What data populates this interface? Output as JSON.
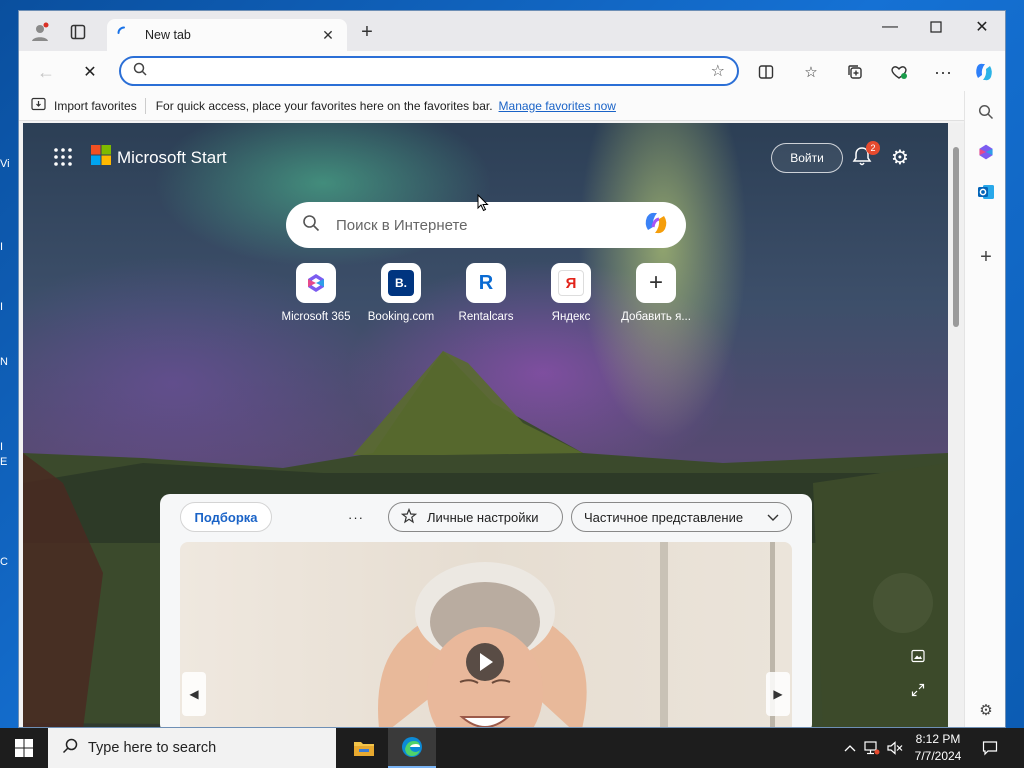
{
  "browser": {
    "tab_title": "New tab",
    "address_value": "",
    "favorites_bar": {
      "import_label": "Import favorites",
      "message": "For quick access, place your favorites here on the favorites bar.",
      "manage_link": "Manage favorites now"
    }
  },
  "page": {
    "brand": "Microsoft Start",
    "signin_label": "Войти",
    "notification_count": "2",
    "search_placeholder": "Поиск в Интернете",
    "shortcuts": [
      {
        "label": "Microsoft 365",
        "icon": "microsoft-365-icon"
      },
      {
        "label": "Booking.com",
        "icon": "booking-icon",
        "glyph": "B."
      },
      {
        "label": "Rentalcars",
        "icon": "rentalcars-icon",
        "glyph": "R"
      },
      {
        "label": "Яндекс",
        "icon": "yandex-icon",
        "glyph": "Я"
      },
      {
        "label": "Добавить я...",
        "icon": "plus-icon",
        "glyph": "+"
      }
    ],
    "feed": {
      "tab_label": "Подборка",
      "more_label": "···",
      "personalize_label": "Личные настройки",
      "view_label": "Частичное представление"
    }
  },
  "taskbar": {
    "search_placeholder": "Type here to search",
    "time": "8:12 PM",
    "date": "7/7/2024"
  },
  "desktop": {
    "icon_label_fragments": [
      "Vi",
      "I",
      "I",
      "N",
      "I",
      "E",
      "C"
    ]
  },
  "colors": {
    "accent": "#2b6fd6",
    "badge": "#e64a2e",
    "link": "#1a63c7"
  }
}
